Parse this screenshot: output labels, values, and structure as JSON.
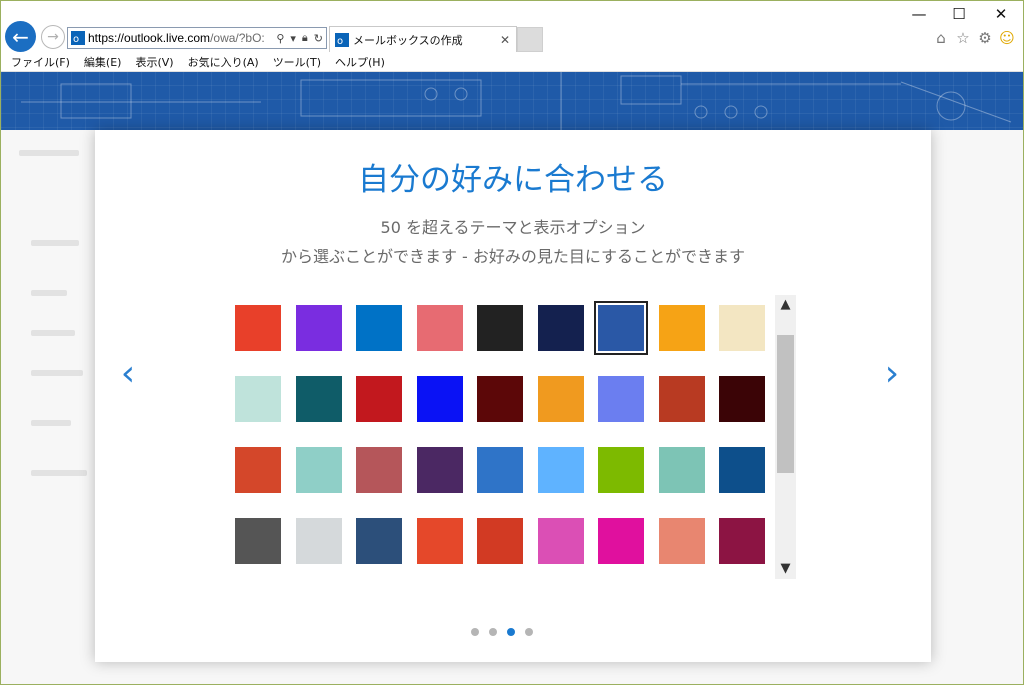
{
  "browser": {
    "address": {
      "url_domain": "https://outlook.live.com",
      "url_rest": "/owa/?bO:"
    },
    "tab": {
      "label": "メールボックスの作成",
      "close": "✕"
    },
    "menu": [
      "ファイル(F)",
      "編集(E)",
      "表示(V)",
      "お気に入り(A)",
      "ツール(T)",
      "ヘルプ(H)"
    ],
    "window_controls": {
      "minimize": "—",
      "maximize": "☐",
      "close": "✕"
    }
  },
  "modal": {
    "title": "自分の好みに合わせる",
    "subtitle_line1": "50 を超えるテーマと表示オプション",
    "subtitle_line2": "から選ぶことができます - お好みの見た目にすることができます",
    "prev_arrow": "‹",
    "next_arrow": "›",
    "themes": [
      {
        "name": "theme-geometric",
        "color": "#e8402a"
      },
      {
        "name": "theme-purple-waves",
        "color": "#7a2de0"
      },
      {
        "name": "theme-blue",
        "color": "#0072c6"
      },
      {
        "name": "theme-palm-sunset",
        "color": "#e76b72"
      },
      {
        "name": "theme-black",
        "color": "#222222"
      },
      {
        "name": "theme-navy",
        "color": "#14214f"
      },
      {
        "name": "theme-blueprint",
        "color": "#2a58a6",
        "selected": true
      },
      {
        "name": "theme-lego",
        "color": "#f6a315"
      },
      {
        "name": "theme-lucky-cat",
        "color": "#f3e6c2"
      },
      {
        "name": "theme-mint-pattern",
        "color": "#bfe3db"
      },
      {
        "name": "theme-circuit",
        "color": "#0f5c68"
      },
      {
        "name": "theme-red-dots",
        "color": "#c2181e"
      },
      {
        "name": "theme-bright-blue",
        "color": "#0a12f5"
      },
      {
        "name": "theme-maroon",
        "color": "#5c0708"
      },
      {
        "name": "theme-crayons",
        "color": "#f09a1f"
      },
      {
        "name": "theme-polygons",
        "color": "#6b7ef0"
      },
      {
        "name": "theme-brush",
        "color": "#b83a22"
      },
      {
        "name": "theme-dark-maroon",
        "color": "#3b0406"
      },
      {
        "name": "theme-orange-red",
        "color": "#d4472a"
      },
      {
        "name": "theme-teal-cubes",
        "color": "#8fcfc7"
      },
      {
        "name": "theme-bokeh",
        "color": "#b5565a"
      },
      {
        "name": "theme-plum",
        "color": "#4b2863"
      },
      {
        "name": "theme-water",
        "color": "#2f74c8"
      },
      {
        "name": "theme-sky",
        "color": "#5fb3ff"
      },
      {
        "name": "theme-lime",
        "color": "#7dba00"
      },
      {
        "name": "theme-teal-split",
        "color": "#7dc4b5"
      },
      {
        "name": "theme-ocean",
        "color": "#0d4f8b"
      },
      {
        "name": "theme-gray-split",
        "color": "#555555"
      },
      {
        "name": "theme-stripes",
        "color": "#d5d9db"
      },
      {
        "name": "theme-mountain",
        "color": "#2c4f7a"
      },
      {
        "name": "theme-vermilion",
        "color": "#e5482a"
      },
      {
        "name": "theme-paint",
        "color": "#d23a23"
      },
      {
        "name": "theme-pink",
        "color": "#db4fb5"
      },
      {
        "name": "theme-magenta",
        "color": "#e0109e"
      },
      {
        "name": "theme-salmon",
        "color": "#e88670"
      },
      {
        "name": "theme-burgundy",
        "color": "#8c1443"
      }
    ],
    "pagination": {
      "count": 4,
      "active_index": 2
    }
  },
  "colors": {
    "accent": "#1a7ad0",
    "banner": "#1f5aa8"
  }
}
